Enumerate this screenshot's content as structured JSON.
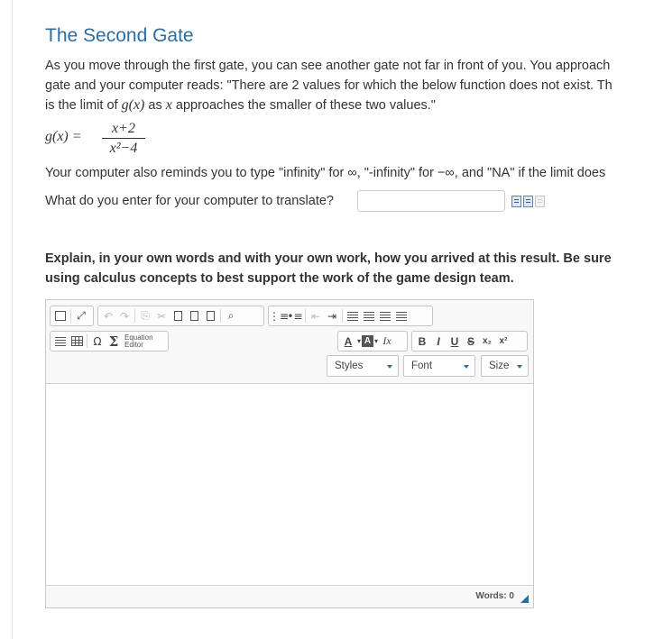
{
  "page": {
    "title": "The Second Gate",
    "intro_lines": [
      "As you move through the first gate, you can see another gate not far in front of you. You approach",
      "gate and your computer reads: \"There are 2 values for which the below function does not exist. Th",
      [
        "is the limit of ",
        "g(x)",
        " as ",
        "x",
        " approaches the smaller of these two values.\""
      ]
    ],
    "formula": {
      "lhs": "g(x) =",
      "numerator": "x+2",
      "denominator": "x²−4"
    },
    "reminder": "Your computer also reminds you to type \"infinity\" for ∞, \"-infinity\" for −∞, and \"NA\" if the limit does",
    "question": "What do you enter for your computer to translate?",
    "answer": {
      "value": "",
      "placeholder": ""
    },
    "explain_lines": [
      "Explain, in your own words and with your own work, how you arrived at this result. Be sure",
      "using calculus concepts to best support the work of the game design team."
    ]
  },
  "editor": {
    "toolbar": {
      "row1_group1": [
        "source-icon",
        "maximize-icon"
      ],
      "row1_group2": [
        "undo-icon",
        "redo-icon",
        "copy-icon",
        "cut-icon",
        "paste-icon",
        "paste-text-icon",
        "paste-word-icon",
        "find-icon"
      ],
      "row1_group3": [
        "numbered-list-icon",
        "bulleted-list-icon",
        "outdent-icon",
        "indent-icon",
        "align-left-icon",
        "align-center-icon",
        "align-right-icon",
        "justify-icon"
      ],
      "row2_group1": [
        "horizontal-line-icon",
        "table-icon",
        "omega-icon",
        "sigma-icon"
      ],
      "equation_editor_label": [
        "Equation",
        "Editor"
      ],
      "text_color_label": "A",
      "bg_color_label": "A",
      "clear_format_label": "Ix",
      "bold_label": "B",
      "italic_label": "I",
      "underline_label": "U",
      "strike_label": "S",
      "subscript_label": "x₂",
      "superscript_label": "x²",
      "styles_label": "Styles",
      "font_label": "Font",
      "size_label": "Size"
    },
    "body_text": "",
    "word_count": "Words: 0",
    "accent_color": "#2a6ea3"
  }
}
